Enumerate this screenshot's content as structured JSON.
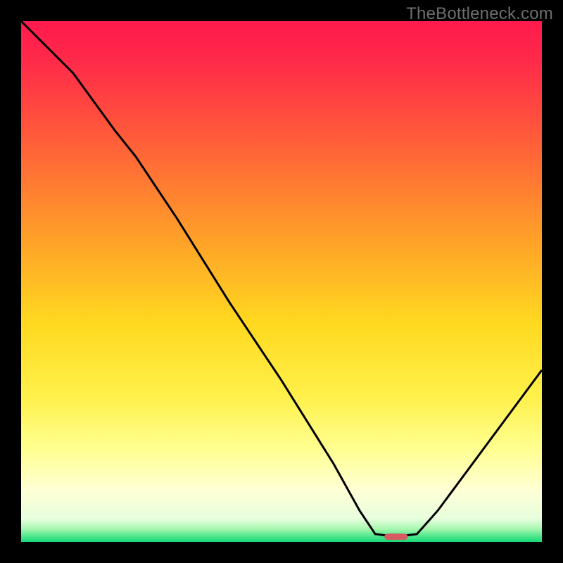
{
  "watermark": "TheBottleneck.com",
  "chart_data": {
    "type": "line",
    "title": "",
    "xlabel": "",
    "ylabel": "",
    "xlim": [
      0,
      100
    ],
    "ylim": [
      0,
      100
    ],
    "background_gradient": {
      "stops": [
        {
          "offset": 0,
          "color": "#ff1a4d"
        },
        {
          "offset": 0.08,
          "color": "#ff2b49"
        },
        {
          "offset": 0.22,
          "color": "#ff5a3a"
        },
        {
          "offset": 0.4,
          "color": "#ff9a2a"
        },
        {
          "offset": 0.58,
          "color": "#ffd91f"
        },
        {
          "offset": 0.72,
          "color": "#fff04a"
        },
        {
          "offset": 0.82,
          "color": "#ffff8f"
        },
        {
          "offset": 0.9,
          "color": "#ffffd5"
        },
        {
          "offset": 0.955,
          "color": "#e8ffde"
        },
        {
          "offset": 0.975,
          "color": "#a8f7b0"
        },
        {
          "offset": 0.99,
          "color": "#49e68a"
        },
        {
          "offset": 1.0,
          "color": "#16d977"
        }
      ]
    },
    "series": [
      {
        "name": "bottleneck-curve",
        "color": "#000000",
        "x": [
          0,
          10,
          18,
          22,
          30,
          40,
          50,
          60,
          65,
          68,
          72,
          76,
          80,
          100
        ],
        "y": [
          100,
          90,
          79,
          74,
          62,
          46,
          31,
          15,
          6,
          1.5,
          1,
          1.5,
          6,
          33
        ]
      }
    ],
    "marker": {
      "name": "optimal-marker",
      "x": 72,
      "y": 1,
      "width_pct": 4.5,
      "height_pct": 1.2,
      "color": "#d85a63"
    }
  }
}
